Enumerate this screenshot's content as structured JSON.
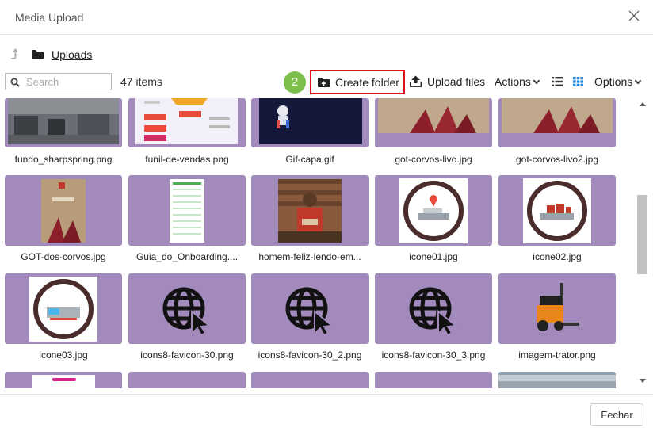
{
  "dialog": {
    "title": "Media Upload"
  },
  "breadcrumb": {
    "current": "Uploads"
  },
  "toolbar": {
    "search_placeholder": "Search",
    "item_count": "47 items",
    "step_number": "2",
    "create_folder": "Create folder",
    "upload_files": "Upload files",
    "actions": "Actions",
    "options": "Options",
    "active_view": "grid"
  },
  "files": [
    {
      "name": "fundo_sharpspring.png"
    },
    {
      "name": "funil-de-vendas.png"
    },
    {
      "name": "Gif-capa.gif"
    },
    {
      "name": "got-corvos-livo.jpg"
    },
    {
      "name": "got-corvos-livo2.jpg"
    },
    {
      "name": "GOT-dos-corvos.jpg"
    },
    {
      "name": "Guia_do_Onboarding...."
    },
    {
      "name": "homem-feliz-lendo-em..."
    },
    {
      "name": "icone01.jpg"
    },
    {
      "name": "icone02.jpg"
    },
    {
      "name": "icone03.jpg"
    },
    {
      "name": "icons8-favicon-30.png"
    },
    {
      "name": "icons8-favicon-30_2.png"
    },
    {
      "name": "icons8-favicon-30_3.png"
    },
    {
      "name": "imagem-trator.png"
    }
  ],
  "footer": {
    "close_label": "Fechar"
  },
  "colors": {
    "tile_bg": "#a28abd",
    "highlight": "#e0111b",
    "step_badge": "#7cc04b",
    "grid_icon_active": "#1e88e5"
  }
}
